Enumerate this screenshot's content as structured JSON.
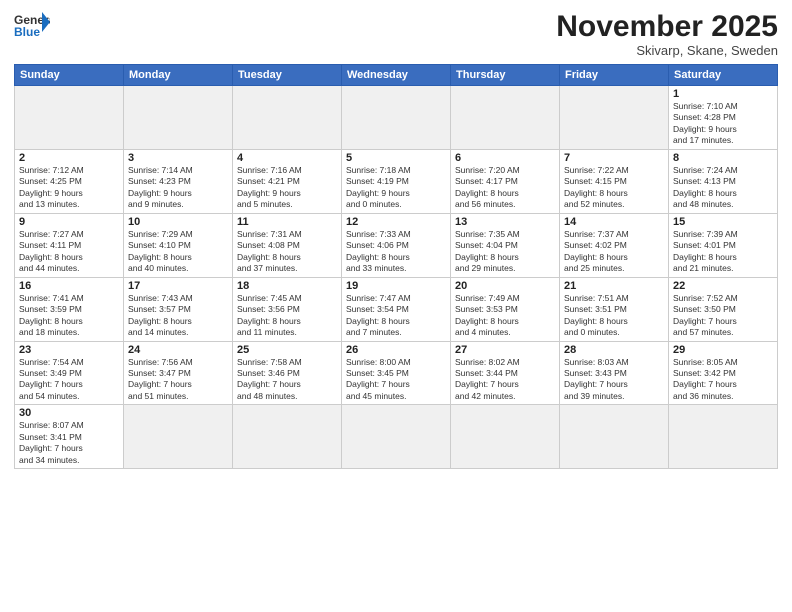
{
  "header": {
    "logo_general": "General",
    "logo_blue": "Blue",
    "month_title": "November 2025",
    "location": "Skivarp, Skane, Sweden"
  },
  "weekdays": [
    "Sunday",
    "Monday",
    "Tuesday",
    "Wednesday",
    "Thursday",
    "Friday",
    "Saturday"
  ],
  "days": [
    {
      "date": "",
      "info": ""
    },
    {
      "date": "",
      "info": ""
    },
    {
      "date": "",
      "info": ""
    },
    {
      "date": "",
      "info": ""
    },
    {
      "date": "",
      "info": ""
    },
    {
      "date": "",
      "info": ""
    },
    {
      "date": "1",
      "info": "Sunrise: 7:10 AM\nSunset: 4:28 PM\nDaylight: 9 hours\nand 17 minutes."
    },
    {
      "date": "2",
      "info": "Sunrise: 7:12 AM\nSunset: 4:25 PM\nDaylight: 9 hours\nand 13 minutes."
    },
    {
      "date": "3",
      "info": "Sunrise: 7:14 AM\nSunset: 4:23 PM\nDaylight: 9 hours\nand 9 minutes."
    },
    {
      "date": "4",
      "info": "Sunrise: 7:16 AM\nSunset: 4:21 PM\nDaylight: 9 hours\nand 5 minutes."
    },
    {
      "date": "5",
      "info": "Sunrise: 7:18 AM\nSunset: 4:19 PM\nDaylight: 9 hours\nand 0 minutes."
    },
    {
      "date": "6",
      "info": "Sunrise: 7:20 AM\nSunset: 4:17 PM\nDaylight: 8 hours\nand 56 minutes."
    },
    {
      "date": "7",
      "info": "Sunrise: 7:22 AM\nSunset: 4:15 PM\nDaylight: 8 hours\nand 52 minutes."
    },
    {
      "date": "8",
      "info": "Sunrise: 7:24 AM\nSunset: 4:13 PM\nDaylight: 8 hours\nand 48 minutes."
    },
    {
      "date": "9",
      "info": "Sunrise: 7:27 AM\nSunset: 4:11 PM\nDaylight: 8 hours\nand 44 minutes."
    },
    {
      "date": "10",
      "info": "Sunrise: 7:29 AM\nSunset: 4:10 PM\nDaylight: 8 hours\nand 40 minutes."
    },
    {
      "date": "11",
      "info": "Sunrise: 7:31 AM\nSunset: 4:08 PM\nDaylight: 8 hours\nand 37 minutes."
    },
    {
      "date": "12",
      "info": "Sunrise: 7:33 AM\nSunset: 4:06 PM\nDaylight: 8 hours\nand 33 minutes."
    },
    {
      "date": "13",
      "info": "Sunrise: 7:35 AM\nSunset: 4:04 PM\nDaylight: 8 hours\nand 29 minutes."
    },
    {
      "date": "14",
      "info": "Sunrise: 7:37 AM\nSunset: 4:02 PM\nDaylight: 8 hours\nand 25 minutes."
    },
    {
      "date": "15",
      "info": "Sunrise: 7:39 AM\nSunset: 4:01 PM\nDaylight: 8 hours\nand 21 minutes."
    },
    {
      "date": "16",
      "info": "Sunrise: 7:41 AM\nSunset: 3:59 PM\nDaylight: 8 hours\nand 18 minutes."
    },
    {
      "date": "17",
      "info": "Sunrise: 7:43 AM\nSunset: 3:57 PM\nDaylight: 8 hours\nand 14 minutes."
    },
    {
      "date": "18",
      "info": "Sunrise: 7:45 AM\nSunset: 3:56 PM\nDaylight: 8 hours\nand 11 minutes."
    },
    {
      "date": "19",
      "info": "Sunrise: 7:47 AM\nSunset: 3:54 PM\nDaylight: 8 hours\nand 7 minutes."
    },
    {
      "date": "20",
      "info": "Sunrise: 7:49 AM\nSunset: 3:53 PM\nDaylight: 8 hours\nand 4 minutes."
    },
    {
      "date": "21",
      "info": "Sunrise: 7:51 AM\nSunset: 3:51 PM\nDaylight: 8 hours\nand 0 minutes."
    },
    {
      "date": "22",
      "info": "Sunrise: 7:52 AM\nSunset: 3:50 PM\nDaylight: 7 hours\nand 57 minutes."
    },
    {
      "date": "23",
      "info": "Sunrise: 7:54 AM\nSunset: 3:49 PM\nDaylight: 7 hours\nand 54 minutes."
    },
    {
      "date": "24",
      "info": "Sunrise: 7:56 AM\nSunset: 3:47 PM\nDaylight: 7 hours\nand 51 minutes."
    },
    {
      "date": "25",
      "info": "Sunrise: 7:58 AM\nSunset: 3:46 PM\nDaylight: 7 hours\nand 48 minutes."
    },
    {
      "date": "26",
      "info": "Sunrise: 8:00 AM\nSunset: 3:45 PM\nDaylight: 7 hours\nand 45 minutes."
    },
    {
      "date": "27",
      "info": "Sunrise: 8:02 AM\nSunset: 3:44 PM\nDaylight: 7 hours\nand 42 minutes."
    },
    {
      "date": "28",
      "info": "Sunrise: 8:03 AM\nSunset: 3:43 PM\nDaylight: 7 hours\nand 39 minutes."
    },
    {
      "date": "29",
      "info": "Sunrise: 8:05 AM\nSunset: 3:42 PM\nDaylight: 7 hours\nand 36 minutes."
    },
    {
      "date": "30",
      "info": "Sunrise: 8:07 AM\nSunset: 3:41 PM\nDaylight: 7 hours\nand 34 minutes."
    },
    {
      "date": "",
      "info": ""
    },
    {
      "date": "",
      "info": ""
    },
    {
      "date": "",
      "info": ""
    },
    {
      "date": "",
      "info": ""
    },
    {
      "date": "",
      "info": ""
    },
    {
      "date": "",
      "info": ""
    }
  ]
}
